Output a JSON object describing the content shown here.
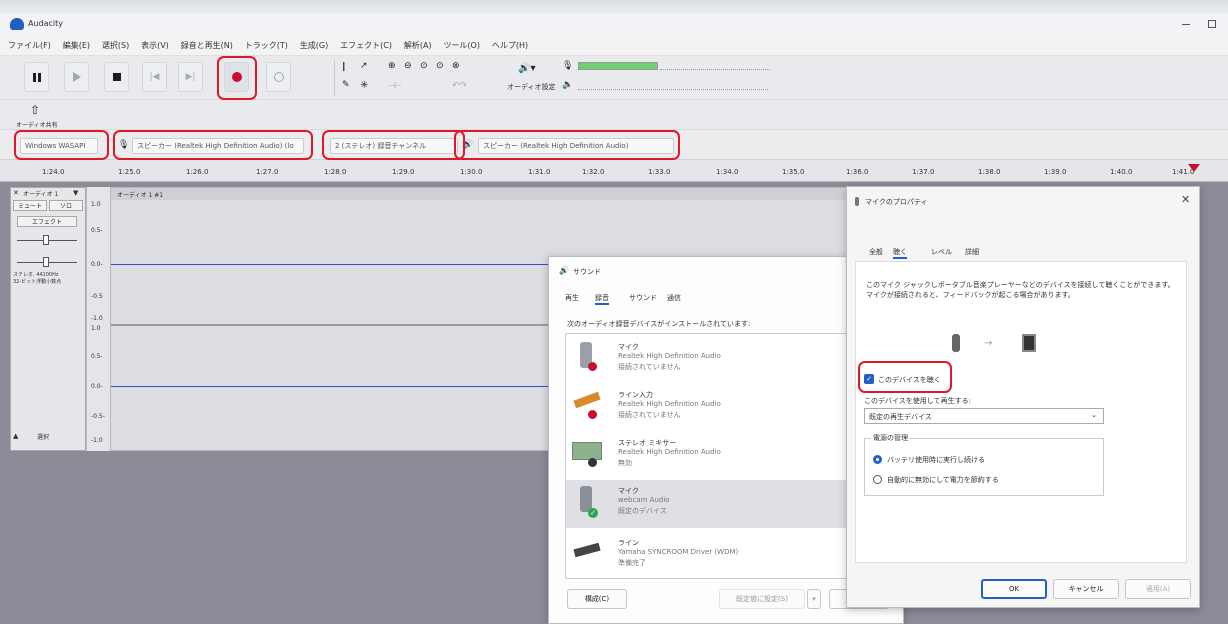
{
  "app": {
    "title": "Audacity",
    "menus": [
      "ファイル(F)",
      "編集(E)",
      "選択(S)",
      "表示(V)",
      "録音と再生(N)",
      "トラック(T)",
      "生成(G)",
      "エフェクト(C)",
      "解析(A)",
      "ツール(O)",
      "ヘルプ(H)"
    ]
  },
  "toolbar": {
    "audio_setup_label": "オーディオ設定",
    "share_label": "オーディオ共有"
  },
  "devices": {
    "host": "Windows WASAPI",
    "recording_device": "スピーカー (Realtek High Definition Audio) (lo",
    "channels": "2 (ステレオ) 録音チャンネル",
    "playback_device": "スピーカー (Realtek High Definition Audio)"
  },
  "ruler": {
    "ticks": [
      "1:24.0",
      "1:25.0",
      "1:26.0",
      "1:27.0",
      "1:28.0",
      "1:29.0",
      "1:30.0",
      "1:31.0",
      "1:32.0",
      "1:33.0",
      "1:34.0",
      "1:35.0",
      "1:36.0",
      "1:37.0",
      "1:38.0",
      "1:39.0",
      "1:40.0",
      "1:41.0"
    ]
  },
  "track": {
    "name": "オーディオ 1",
    "clip_name": "オーディオ 1 #1",
    "mute": "ミュート",
    "solo": "ソロ",
    "effects": "エフェクト",
    "info": "ステレオ, 44100Hz\n32-ビット浮動小数点",
    "select": "選択",
    "scale": [
      "1.0",
      "0.5-",
      "0.0-",
      "-0.5",
      "-1.0",
      "1.0",
      "0.5-",
      "0.0-",
      "-0.5-",
      "-1.0"
    ]
  },
  "sound_dialog": {
    "title": "サウンド",
    "tabs": [
      "再生",
      "録音",
      "サウンド",
      "通信"
    ],
    "description": "次のオーディオ録音デバイスがインストールされています:",
    "devices": [
      {
        "name": "マイク",
        "driver": "Realtek High Definition Audio",
        "status": "接続されていません"
      },
      {
        "name": "ライン入力",
        "driver": "Realtek High Definition Audio",
        "status": "接続されていません"
      },
      {
        "name": "ステレオ ミキサー",
        "driver": "Realtek High Definition Audio",
        "status": "無効"
      },
      {
        "name": "マイク",
        "driver": "webcam Audio",
        "status": "既定のデバイス"
      },
      {
        "name": "ライン",
        "driver": "Yamaha SYNCROOM Driver (WDM)",
        "status": "準備完了"
      }
    ],
    "configure_btn": "構成(C)",
    "set_default_btn": "既定値に設定(S)",
    "properties_btn": "プロパ"
  },
  "mic_props": {
    "title": "マイクのプロパティ",
    "tabs": [
      "全般",
      "聴く",
      "レベル",
      "詳細"
    ],
    "description": "このマイク ジャックしポータブル音楽プレーヤーなどのデバイスを接続して聴くことができます。マイクが接続されると、フィードバックが起こる場合があります。",
    "listen_checkbox": "このデバイスを聴く",
    "playback_label": "このデバイスを使用して再生する:",
    "playback_value": "既定の再生デバイス",
    "power_group": "電源の管理",
    "power_opt1": "バッテリ使用時に実行し続ける",
    "power_opt2": "自動的に無効にして電力を節約する",
    "ok": "OK",
    "cancel": "キャンセル",
    "apply": "適用(A)"
  },
  "colors": {
    "annotation": "#e0182b",
    "record": "#c8102e",
    "selection_bg": "#dcdde2",
    "workspace": "#8c8b98"
  }
}
